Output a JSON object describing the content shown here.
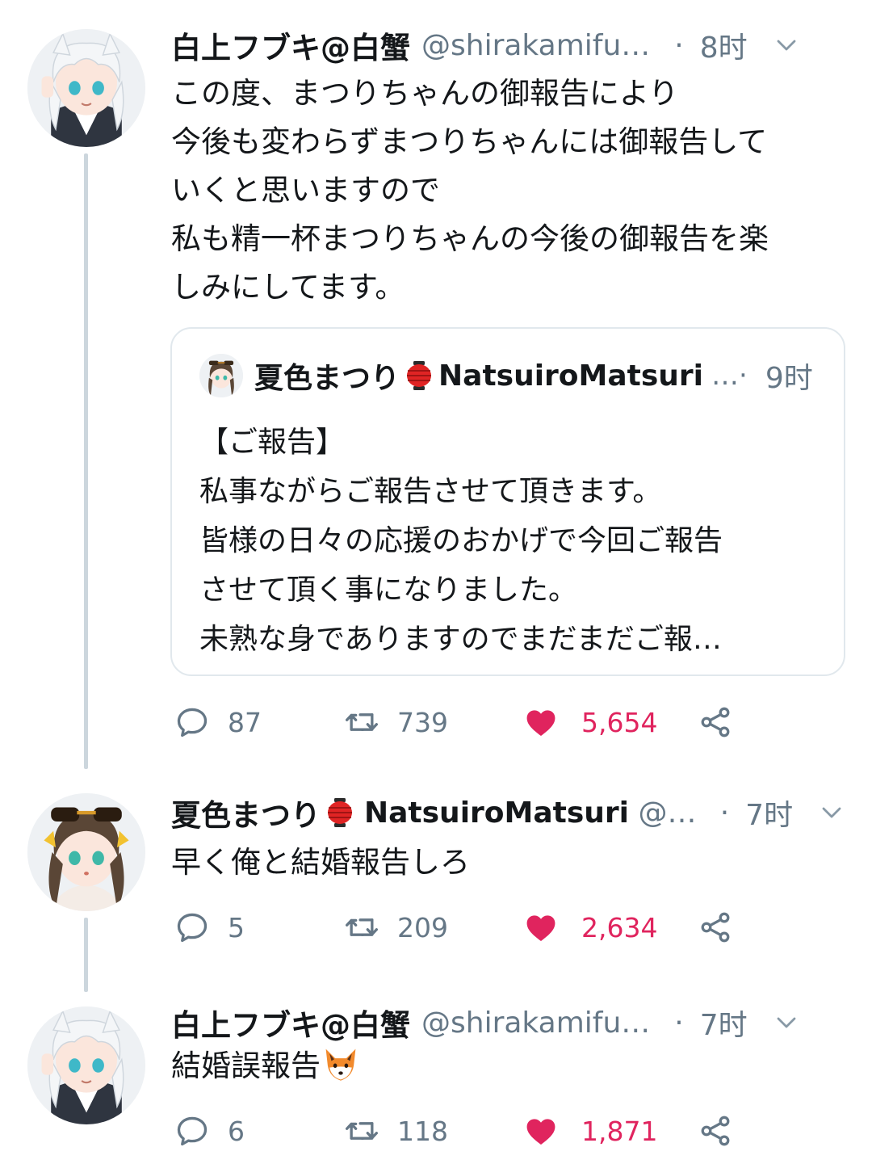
{
  "tweets": [
    {
      "display_name": "白上フブキ@白蟹",
      "handle": "@shirakamifu…",
      "separator": "·",
      "time": "8时",
      "text_lines": [
        "この度、まつりちゃんの御報告により",
        "今後も変わらずまつりちゃんには御報告して",
        "いくと思いますので",
        "私も精一杯まつりちゃんの今後の御報告を楽",
        "しみにしてます。"
      ],
      "quote": {
        "display_name": "夏色まつり",
        "handle": "NatsuiroMatsuri",
        "dots": "…·",
        "time": "9时",
        "text_lines": [
          "【ご報告】",
          "私事ながらご報告させて頂きます。",
          "皆様の日々の応援のおかげで今回ご報告",
          "させて頂く事になりました。",
          "未熟な身でありますのでまだまだご報…"
        ]
      },
      "replies": "87",
      "retweets": "739",
      "likes": "5,654"
    },
    {
      "display_name": "夏色まつり",
      "handle": "NatsuiroMatsuri @…",
      "separator": "·",
      "time": "7时",
      "text": "早く俺と結婚報告しろ",
      "replies": "5",
      "retweets": "209",
      "likes": "2,634"
    },
    {
      "display_name": "白上フブキ@白蟹",
      "handle": "@shirakamifu…",
      "separator": "·",
      "time": "7时",
      "text": "結婚誤報告",
      "replies": "6",
      "retweets": "118",
      "likes": "1,871"
    }
  ],
  "colors": {
    "text": "#14171a",
    "secondary": "#657786",
    "like": "#e0245e",
    "thread_line": "#ccd6dd",
    "border": "#e1e8ed"
  },
  "icons": [
    "reply-icon",
    "retweet-icon",
    "heart-icon",
    "share-icon",
    "chevron-down-icon",
    "lantern-emoji",
    "fox-emoji"
  ]
}
